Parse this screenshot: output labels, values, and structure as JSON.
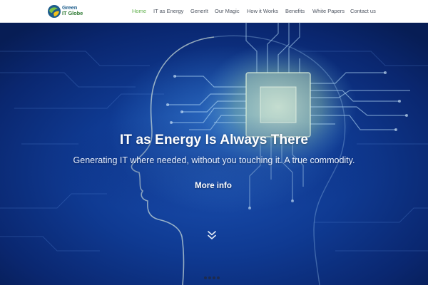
{
  "brand": {
    "name_line1": "Green",
    "name_line2": "IT Globe",
    "colors": {
      "blue": "#1d5d8c",
      "green": "#2f7a34",
      "leaf": "#7cc243"
    }
  },
  "nav": {
    "active_color": "#5fb04b",
    "items": [
      {
        "label": "Home",
        "active": true
      },
      {
        "label": "IT as Energy",
        "active": false
      },
      {
        "label": "GenerIt",
        "active": false
      },
      {
        "label": "Our Magic",
        "active": false
      },
      {
        "label": "How it Works",
        "active": false
      },
      {
        "label": "Benefits",
        "active": false
      },
      {
        "label": "White Papers",
        "active": false
      },
      {
        "label": "Contact us",
        "active": false
      }
    ]
  },
  "hero": {
    "title": "IT as Energy Is Always There",
    "subtitle": "Generating IT where needed, without you touching it. A true commodity.",
    "cta_label": "More info",
    "scroll_icon": "double-chevron-down-icon",
    "slide_count": 4,
    "active_slide": 1
  }
}
